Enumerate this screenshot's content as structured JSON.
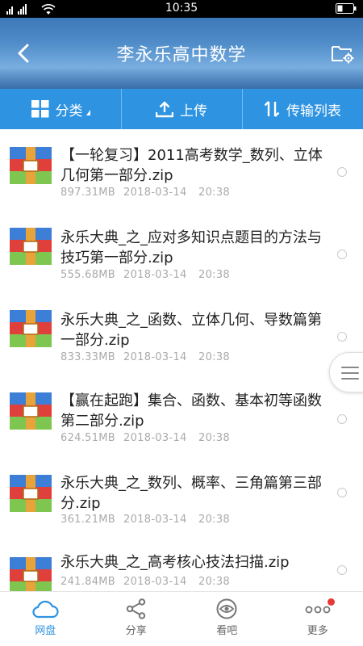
{
  "status": {
    "time": "10:35"
  },
  "header": {
    "title": "李永乐高中数学"
  },
  "toolbar": {
    "category": "分类",
    "upload": "上传",
    "transfer": "传输列表"
  },
  "files": [
    {
      "name": "【一轮复习】2011高考数学_数列、立体几何第一部分.zip",
      "size": "897.31MB",
      "date": "2018-03-14",
      "time": "20:38"
    },
    {
      "name": "永乐大典_之_应对多知识点题目的方法与技巧第一部分.zip",
      "size": "555.68MB",
      "date": "2018-03-14",
      "time": "20:38"
    },
    {
      "name": "永乐大典_之_函数、立体几何、导数篇第一部分.zip",
      "size": "833.33MB",
      "date": "2018-03-14",
      "time": "20:38"
    },
    {
      "name": "【赢在起跑】集合、函数、基本初等函数第二部分.zip",
      "size": "624.51MB",
      "date": "2018-03-14",
      "time": "20:38"
    },
    {
      "name": "永乐大典_之_数列、概率、三角篇第三部分.zip",
      "size": "361.21MB",
      "date": "2018-03-14",
      "time": "20:38"
    },
    {
      "name": "永乐大典_之_高考核心技法扫描.zip",
      "size": "241.84MB",
      "date": "2018-03-14",
      "time": "20:38"
    }
  ],
  "nav": {
    "disk": "网盘",
    "share": "分享",
    "watch": "看吧",
    "more": "更多"
  },
  "colors": {
    "accent": "#2e93e0",
    "badge": "#e53935"
  }
}
